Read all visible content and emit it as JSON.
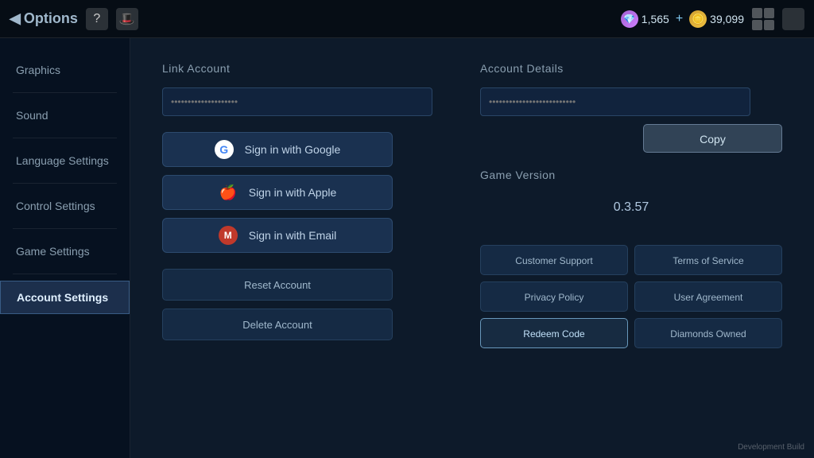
{
  "topbar": {
    "back_label": "◀",
    "title": "Options",
    "question_icon": "?",
    "hat_icon": "🎩",
    "gem_count": "1,565",
    "add_icon": "+",
    "coin_icon": "🪙",
    "coin_count": "39,099",
    "gem_icon": "💎",
    "grid_icon": "⊞",
    "square_icon": "⬜"
  },
  "sidebar": {
    "items": [
      {
        "id": "graphics",
        "label": "Graphics",
        "active": false
      },
      {
        "id": "sound",
        "label": "Sound",
        "active": false
      },
      {
        "id": "language-settings",
        "label": "Language Settings",
        "active": false
      },
      {
        "id": "control-settings",
        "label": "Control Settings",
        "active": false
      },
      {
        "id": "game-settings",
        "label": "Game Settings",
        "active": false
      },
      {
        "id": "account-settings",
        "label": "Account Settings",
        "active": true
      }
    ]
  },
  "link_account": {
    "section_title": "Link Account",
    "input_placeholder": "••••••••••••••••••••",
    "sign_in_buttons": [
      {
        "id": "google",
        "label": "Sign in with Google",
        "icon_text": "G"
      },
      {
        "id": "apple",
        "label": "Sign in with Apple",
        "icon_text": ""
      },
      {
        "id": "email",
        "label": "Sign in with Email",
        "icon_text": "M"
      }
    ],
    "reset_label": "Reset Account",
    "delete_label": "Delete Account"
  },
  "account_details": {
    "section_title": "Account Details",
    "input_placeholder": "••••••••••••••••••••••••••",
    "copy_label": "Copy",
    "game_version_label": "Game Version",
    "game_version_number": "0.3.57",
    "buttons": [
      {
        "id": "customer-support",
        "label": "Customer Support",
        "highlight": false
      },
      {
        "id": "terms-of-service",
        "label": "Terms of Service",
        "highlight": false
      },
      {
        "id": "privacy-policy",
        "label": "Privacy Policy",
        "highlight": false
      },
      {
        "id": "user-agreement",
        "label": "User Agreement",
        "highlight": false
      },
      {
        "id": "redeem-code",
        "label": "Redeem Code",
        "highlight": true
      },
      {
        "id": "diamonds-owned",
        "label": "Diamonds Owned",
        "highlight": false
      }
    ]
  },
  "dev_build_label": "Development Build"
}
